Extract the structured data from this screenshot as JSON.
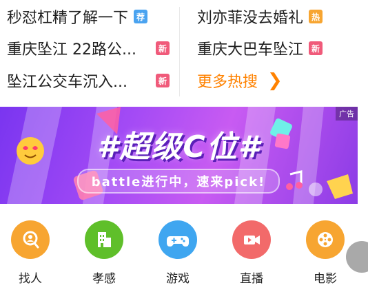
{
  "hot_search": {
    "left": [
      {
        "text": "秒怼杠精了解一下",
        "badge": "荐",
        "badge_color": "#4aa3f0"
      },
      {
        "text": "重庆坠江 22路公...",
        "badge": "新",
        "badge_color": "#f05a7a"
      },
      {
        "text": "坠江公交车沉入...",
        "badge": "新",
        "badge_color": "#f05a7a"
      }
    ],
    "right": [
      {
        "text": "刘亦菲没去婚礼",
        "badge": "热",
        "badge_color": "#f7a531"
      },
      {
        "text": "重庆大巴车坠江",
        "badge": "新",
        "badge_color": "#f05a7a"
      }
    ],
    "more_label": "更多热搜",
    "more_color": "#ff8200"
  },
  "banner": {
    "ad_label": "广告",
    "headline": "#超级C位#",
    "subline": "battle进行中，速来pick!"
  },
  "shortcuts": [
    {
      "label": "找人",
      "icon": "find-person-icon",
      "color": "#f7a531"
    },
    {
      "label": "孝感",
      "icon": "city-building-icon",
      "color": "#5fbf2a"
    },
    {
      "label": "游戏",
      "icon": "gamepad-icon",
      "color": "#3fa6f0"
    },
    {
      "label": "直播",
      "icon": "live-camera-icon",
      "color": "#f26a6a"
    },
    {
      "label": "电影",
      "icon": "film-reel-icon",
      "color": "#f7a531"
    }
  ]
}
